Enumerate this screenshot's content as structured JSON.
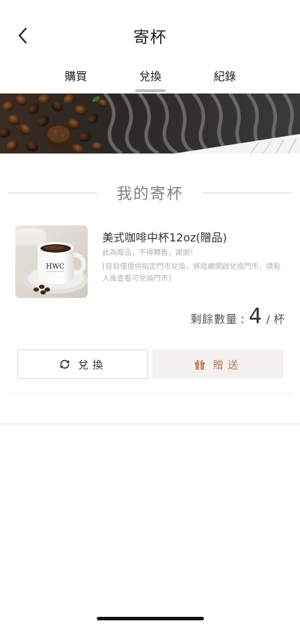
{
  "header": {
    "title": "寄杯"
  },
  "tabs": [
    {
      "label": "購買",
      "active": false
    },
    {
      "label": "兌換",
      "active": true
    },
    {
      "label": "紀錄",
      "active": false
    }
  ],
  "section": {
    "title": "我的寄杯"
  },
  "cup": {
    "image_text": "HWC",
    "name": "美式咖啡中杯12oz(贈品)",
    "note_1": "此為贈品，不得轉售，謝謝！",
    "note_2": "[目前僅提供指定門市兌換，將陸續開啟兌換門市，請點入後查看可兌換門市]",
    "remaining_label": "剩餘數量",
    "remaining_colon": ":",
    "remaining_count": "4",
    "remaining_unit": "/ 杯",
    "redeem_label": "兌換",
    "gift_label": "贈送"
  },
  "colors": {
    "accent_gift": "#b9775e",
    "tab_indicator": "#bfbfbf"
  }
}
